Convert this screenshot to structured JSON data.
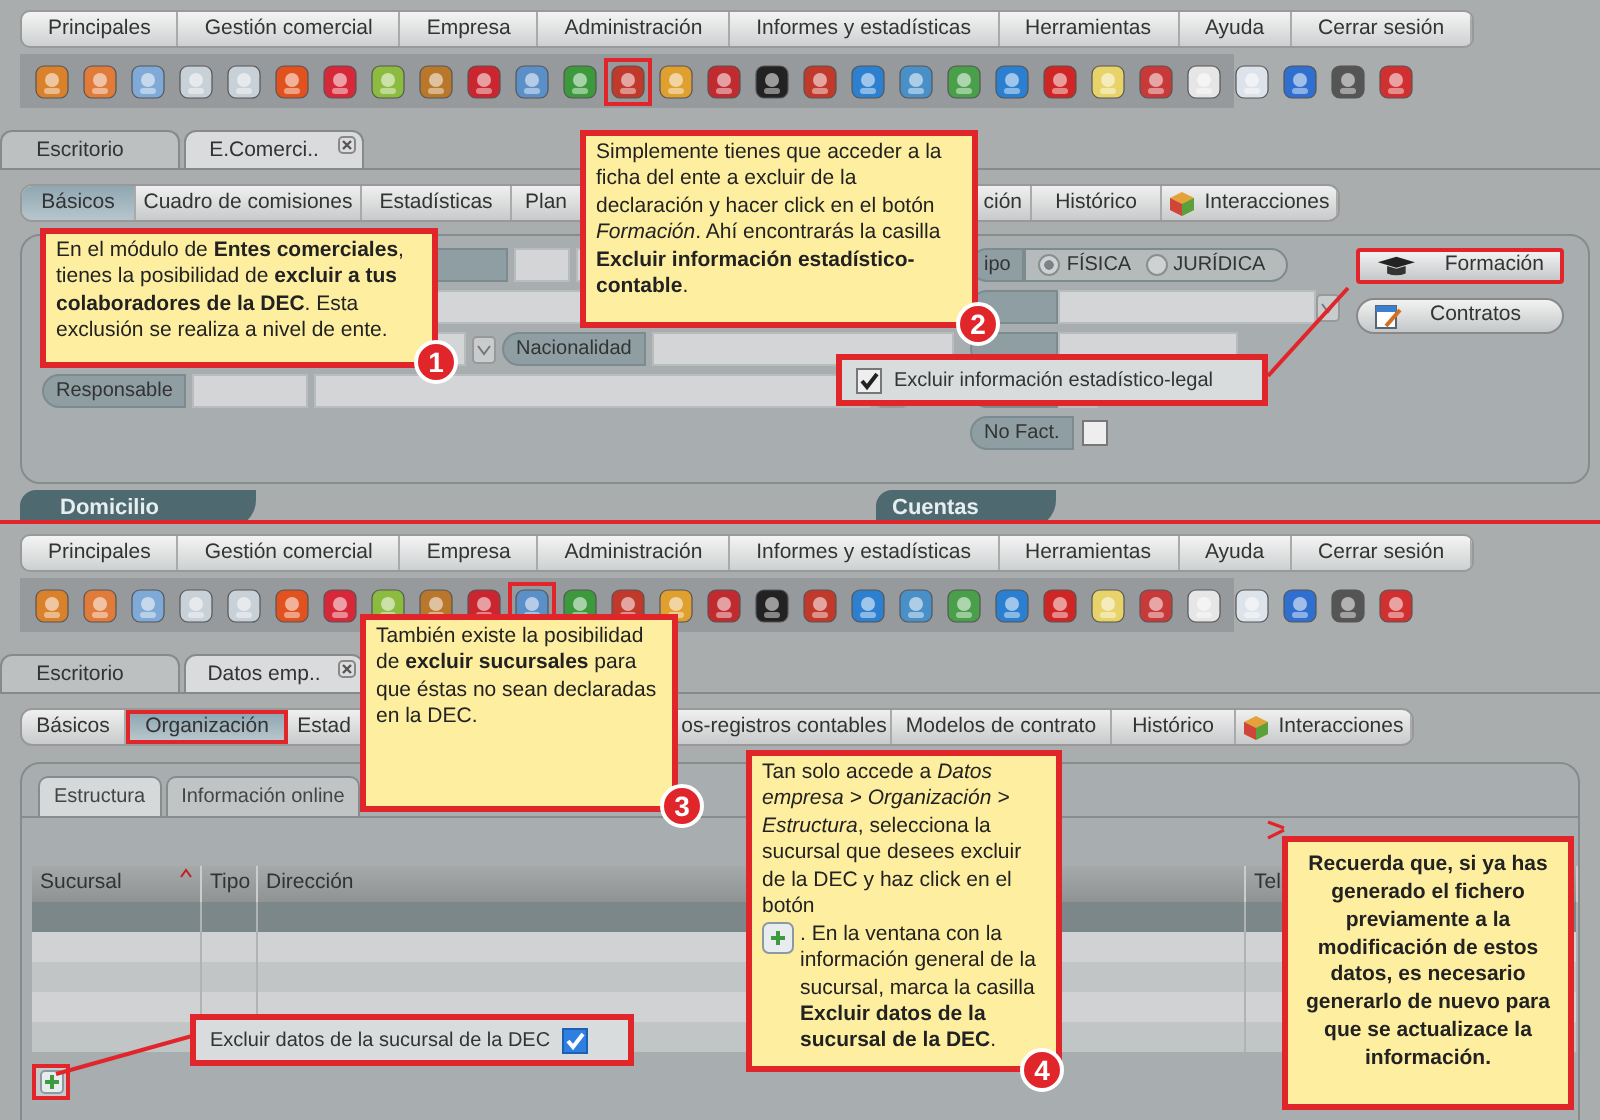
{
  "screens": [
    {
      "menu": [
        "Principales",
        "Gestión comercial",
        "Empresa",
        "Administración",
        "Informes y estadísticas",
        "Herramientas",
        "Ayuda",
        "Cerrar sesión"
      ],
      "toolbar": [
        {
          "highlighted": false
        },
        {
          "highlighted": false
        },
        {
          "highlighted": false
        },
        {
          "highlighted": false
        },
        {
          "highlighted": false
        },
        {
          "highlighted": false
        },
        {
          "highlighted": false
        },
        {
          "highlighted": false
        },
        {
          "highlighted": false
        },
        {
          "highlighted": false
        },
        {
          "highlighted": false
        },
        {
          "highlighted": false
        },
        {
          "highlighted": true
        },
        {
          "highlighted": false
        },
        {
          "highlighted": false
        },
        {
          "highlighted": false
        },
        {
          "highlighted": false
        },
        {
          "highlighted": false
        },
        {
          "highlighted": false
        },
        {
          "highlighted": false
        },
        {
          "highlighted": false
        },
        {
          "highlighted": false
        },
        {
          "highlighted": false
        },
        {
          "highlighted": false
        },
        {
          "highlighted": false
        },
        {
          "highlighted": false
        },
        {
          "highlighted": false
        },
        {
          "highlighted": false
        },
        {
          "highlighted": false
        }
      ],
      "doc_tabs": [
        {
          "label": "Escritorio",
          "selected": false,
          "closable": false
        },
        {
          "label": "E.Comerci..",
          "selected": true,
          "closable": true
        }
      ],
      "sub_tabs": [
        {
          "label": "Básicos",
          "selected": true,
          "highlighted": false
        },
        {
          "label": "Cuadro de comisiones",
          "selected": false,
          "highlighted": false
        },
        {
          "label": "Estadísticas",
          "selected": false,
          "highlighted": false
        },
        {
          "label": "Plan",
          "selected": false,
          "highlighted": false
        },
        {
          "label": "ción",
          "selected": false,
          "highlighted": false
        },
        {
          "label": "Histórico",
          "selected": false,
          "highlighted": false
        },
        {
          "label": "Interacciones",
          "selected": false,
          "highlighted": false,
          "kind": "icon"
        }
      ],
      "entity_form": {
        "type_label": "ipo",
        "type_options": [
          {
            "label": "FÍSICA",
            "selected": true
          },
          {
            "label": "JURÍDICA",
            "selected": false
          }
        ],
        "nationality_label": "Nacionalidad",
        "responsible_label": "Responsable",
        "no_fact": {
          "label": "No Fact.",
          "checked": false
        },
        "buttons": [
          {
            "label": "Formación",
            "kind": "training",
            "highlighted": true
          },
          {
            "label": "Contratos",
            "kind": "contracts",
            "highlighted": false
          }
        ]
      },
      "sections": [
        "Domicilio",
        "Cuentas"
      ],
      "exclude_checkbox": {
        "label": "Excluir información estadístico-legal",
        "checked": true
      },
      "callouts": [
        {
          "kind": "step",
          "text": [
            "En el módulo de **Entes comerciales**, tienes la posibilidad de **excluir a tus colaboradores de la DEC**. Esta exclusión se realiza a nivel de ente."
          ],
          "badge": "1"
        },
        {
          "kind": "step",
          "text": [
            "Simplemente tienes que acceder a la ficha del ente a excluir de la declaración y hacer click en el botón *Formación*. Ahí encontrarás la casilla **Excluir información estadístico-contable**."
          ],
          "badge": "2"
        }
      ]
    },
    {
      "menu": [
        "Principales",
        "Gestión comercial",
        "Empresa",
        "Administración",
        "Informes y estadísticas",
        "Herramientas",
        "Ayuda",
        "Cerrar sesión"
      ],
      "toolbar": [
        {
          "highlighted": false
        },
        {
          "highlighted": false
        },
        {
          "highlighted": false
        },
        {
          "highlighted": false
        },
        {
          "highlighted": false
        },
        {
          "highlighted": false
        },
        {
          "highlighted": false
        },
        {
          "highlighted": false
        },
        {
          "highlighted": false
        },
        {
          "highlighted": false
        },
        {
          "highlighted": true
        },
        {
          "highlighted": false
        },
        {
          "highlighted": false
        },
        {
          "highlighted": false
        },
        {
          "highlighted": false
        },
        {
          "highlighted": false
        },
        {
          "highlighted": false
        },
        {
          "highlighted": false
        },
        {
          "highlighted": false
        },
        {
          "highlighted": false
        },
        {
          "highlighted": false
        },
        {
          "highlighted": false
        },
        {
          "highlighted": false
        },
        {
          "highlighted": false
        },
        {
          "highlighted": false
        },
        {
          "highlighted": false
        },
        {
          "highlighted": false
        },
        {
          "highlighted": false
        },
        {
          "highlighted": false
        }
      ],
      "doc_tabs": [
        {
          "label": "Escritorio",
          "selected": false,
          "closable": false
        },
        {
          "label": "Datos emp..",
          "selected": true,
          "closable": true
        }
      ],
      "sub_tabs": [
        {
          "label": "Básicos",
          "selected": false,
          "highlighted": false
        },
        {
          "label": "Organización",
          "selected": true,
          "highlighted": true
        },
        {
          "label": "Estad",
          "selected": false,
          "highlighted": false
        },
        {
          "label": "os-registros contables",
          "selected": false,
          "highlighted": false
        },
        {
          "label": "Modelos de contrato",
          "selected": false,
          "highlighted": false
        },
        {
          "label": "Histórico",
          "selected": false,
          "highlighted": false
        },
        {
          "label": "Interacciones",
          "selected": false,
          "highlighted": false,
          "kind": "icon"
        }
      ],
      "inner_tabs": [
        {
          "label": "Estructura",
          "selected": true
        },
        {
          "label": "Información online",
          "selected": false
        }
      ],
      "table": {
        "columns": [
          "Sucursal",
          "Tipo",
          "Dirección",
          "Tel"
        ],
        "rows": [
          {
            "selected": true
          },
          {
            "selected": false
          },
          {
            "selected": false
          },
          {
            "selected": false
          },
          {
            "selected": false
          }
        ]
      },
      "exclude_checkbox": {
        "label": "Excluir datos de la sucursal de la DEC",
        "checked": true
      },
      "add_button": {
        "highlighted": true
      },
      "callouts": [
        {
          "kind": "step",
          "text": [
            "También existe la posibilidad de **excluir sucursales** para que éstas no sean declaradas en la DEC."
          ],
          "badge": "3"
        },
        {
          "kind": "step",
          "text": [
            "Tan solo accede a *Datos empresa > Organización > Estructura*, selecciona la sucursal que desees excluir de la DEC y haz click en el botón",
            ". En la ventana con la información general de la sucursal, marca la casilla **Excluir datos de la sucursal de la DEC**."
          ],
          "badge": "4"
        },
        {
          "kind": "note",
          "text": [
            "Recuerda que, si ya has generado el fichero previamente a la modificación de estos datos, es necesario generarlo de nuevo para que se actualizace la información."
          ]
        }
      ]
    }
  ]
}
